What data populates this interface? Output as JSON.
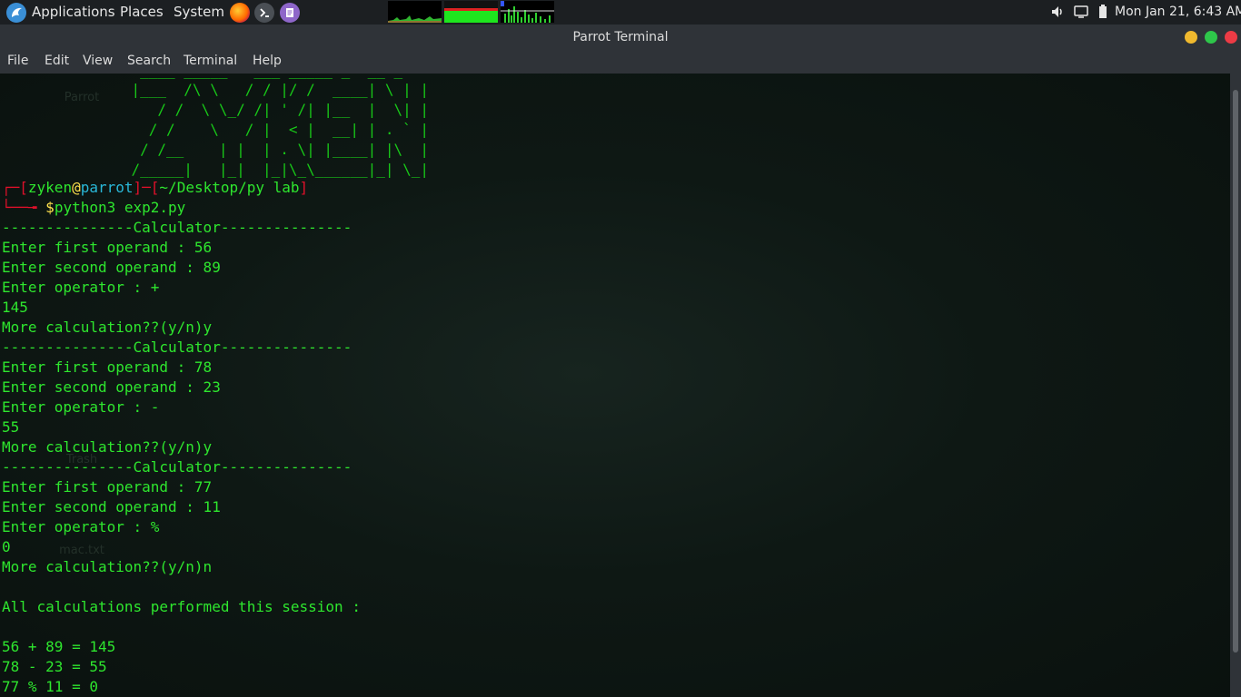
{
  "topbar": {
    "applications": "Applications",
    "places": "Places",
    "system": "System",
    "datetime": "Mon Jan 21,  6:43 AM",
    "icons": [
      "parrot-logo-icon",
      "firefox-icon",
      "terminal-launcher-icon",
      "text-editor-icon",
      "volume-icon",
      "display-icon",
      "battery-icon"
    ]
  },
  "window": {
    "title": "Parrot Terminal",
    "controls": [
      "minimize-button",
      "maximize-button",
      "close-button"
    ]
  },
  "menu": [
    "File",
    "Edit",
    "View",
    "Search",
    "Terminal",
    "Help"
  ],
  "desktop_ghost_labels": [
    "Parrot",
    "Trash",
    "mac.txt"
  ],
  "ascii_art": [
    "                ____ _____   ___ _____ _  __ _",
    "               |___  /\\ \\   / / |/ /  ____| \\ | |",
    "                  / /  \\ \\_/ /| ' /| |__  |  \\| |",
    "                 / /    \\   / |  < |  __| | . ` |",
    "                / /__    | |  | . \\| |____| |\\  |",
    "               /_____|   |_|  |_|\\_\\______|_| \\_|"
  ],
  "prompt": {
    "user": "zyken",
    "at": "@",
    "host": "parrot",
    "path": "~/Desktop/py lab",
    "symbol": "$",
    "command": "python3 exp2.py"
  },
  "output": [
    "---------------Calculator---------------",
    "Enter first operand : 56",
    "Enter second operand : 89",
    "Enter operator : +",
    "145",
    "More calculation??(y/n)y",
    "---------------Calculator---------------",
    "Enter first operand : 78",
    "Enter second operand : 23",
    "Enter operator : -",
    "55",
    "More calculation??(y/n)y",
    "---------------Calculator---------------",
    "Enter first operand : 77",
    "Enter second operand : 11",
    "Enter operator : %",
    "0",
    "More calculation??(y/n)n",
    "",
    "All calculations performed this session :",
    "",
    "56 + 89 = 145",
    "78 - 23 = 55",
    "77 % 11 = 0"
  ],
  "colors": {
    "terminal_text": "#2ee62e",
    "prompt_bracket": "#e0102a",
    "host": "#29b8d8",
    "dollar": "#ffe14d"
  }
}
